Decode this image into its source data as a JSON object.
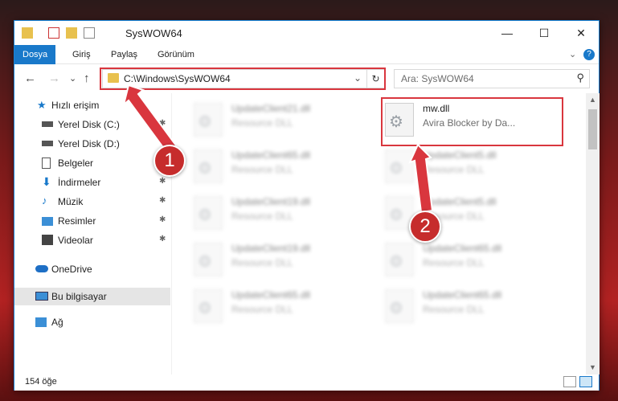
{
  "window": {
    "title": "SysWOW64",
    "min_label": "—",
    "max_label": "☐",
    "close_label": "✕"
  },
  "ribbon": {
    "tabs": [
      "Dosya",
      "Giriş",
      "Paylaş",
      "Görünüm"
    ],
    "collapse_label": "⌄",
    "help_label": "?"
  },
  "nav": {
    "back": "←",
    "forward": "→",
    "recent": "⌄",
    "up": "↑"
  },
  "address": {
    "path": "C:\\Windows\\SysWOW64",
    "refresh": "↻"
  },
  "search": {
    "placeholder": "Ara: SysWOW64"
  },
  "sidebar": {
    "items": [
      {
        "label": "Hızlı erişim",
        "icon": "star-icon"
      },
      {
        "label": "Yerel Disk (C:)",
        "icon": "drive-icon",
        "pinned": true
      },
      {
        "label": "Yerel Disk (D:)",
        "icon": "drive-icon"
      },
      {
        "label": "Belgeler",
        "icon": "documents-icon"
      },
      {
        "label": "İndirmeler",
        "icon": "download-icon",
        "pinned": true
      },
      {
        "label": "Müzik",
        "icon": "music-icon",
        "pinned": true
      },
      {
        "label": "Resimler",
        "icon": "pictures-icon",
        "pinned": true
      },
      {
        "label": "Videolar",
        "icon": "video-icon",
        "pinned": true
      },
      {
        "label": "OneDrive",
        "icon": "cloud-icon"
      },
      {
        "label": "Bu bilgisayar",
        "icon": "computer-icon",
        "selected": true
      },
      {
        "label": "Ağ",
        "icon": "network-icon"
      }
    ]
  },
  "files": [
    {
      "name": "UpdateClient21.dll",
      "desc": "Resource DLL"
    },
    {
      "name": "mw.dll",
      "desc": "Avira Blocker by Da..."
    },
    {
      "name": "UpdateClient65.dll",
      "desc": "Resource DLL"
    },
    {
      "name": "UpdateClient5.dll",
      "desc": "Resource DLL"
    },
    {
      "name": "UpdateClient19.dll",
      "desc": "Resource DLL"
    },
    {
      "name": "UpdateClient5.dll",
      "desc": "Resource DLL"
    },
    {
      "name": "UpdateClient19.dll",
      "desc": "Resource DLL"
    },
    {
      "name": "UpdateClient65.dll",
      "desc": "Resource DLL"
    },
    {
      "name": "UpdateClient65.dll",
      "desc": "Resource DLL"
    },
    {
      "name": "UpdateClient65.dll",
      "desc": "Resource DLL"
    }
  ],
  "status": {
    "count": "154 öğe"
  },
  "callouts": {
    "one": "1",
    "two": "2"
  },
  "colors": {
    "accent": "#1979ca",
    "highlight_red": "#d9363e",
    "callout_red": "#c62c2c"
  }
}
